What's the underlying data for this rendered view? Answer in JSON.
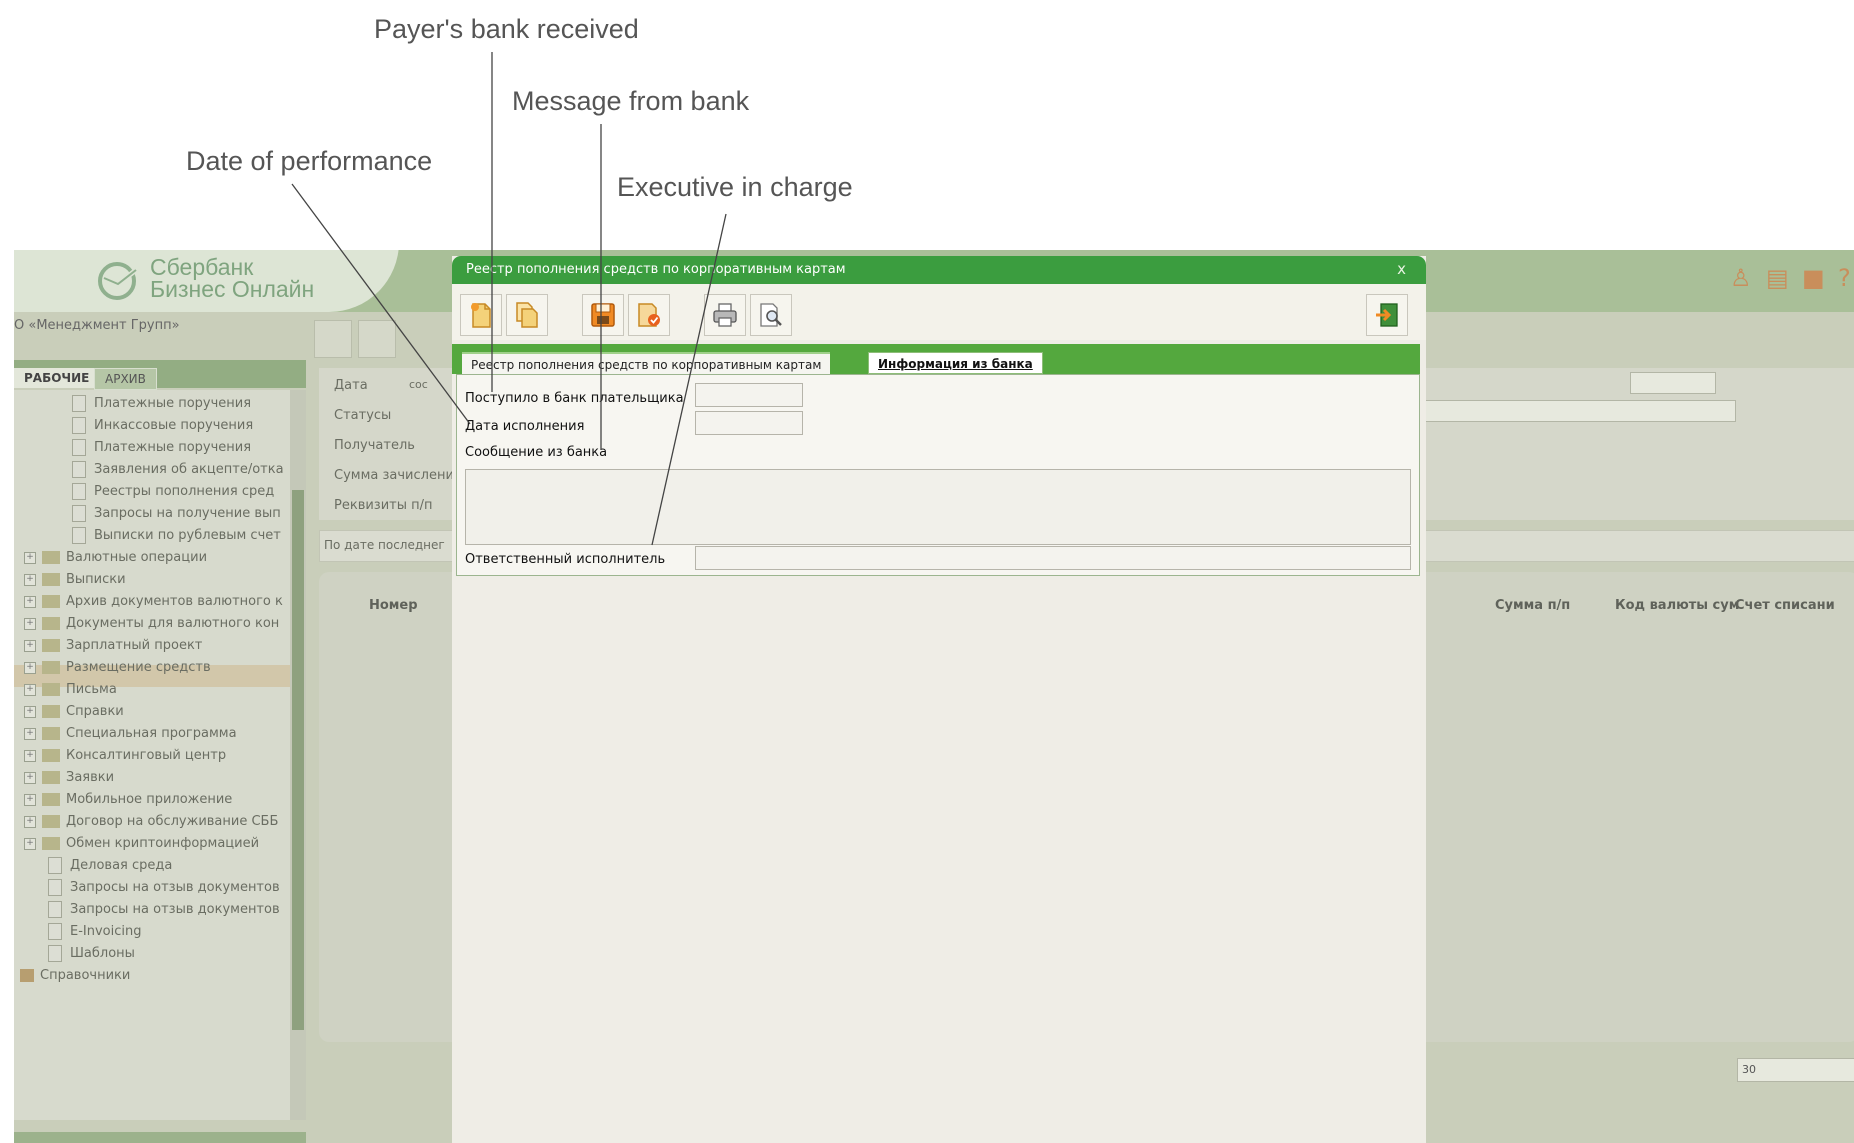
{
  "annotations": {
    "payers_bank_received": "Payer's bank received",
    "message_from_bank": "Message from bank",
    "date_of_performance": "Date of performance",
    "executive_in_charge": "Executive in charge"
  },
  "background_app": {
    "logo": {
      "line1": "Сбербанк",
      "line2": "Бизнес Онлайн"
    },
    "org_name": "О «Менеджмент Групп»",
    "tabs": {
      "working": "РАБОЧИЕ",
      "archive": "АРХИВ"
    },
    "tree": [
      "Платежные поручения",
      "Инкассовые поручения",
      "Платежные поручения",
      "Заявления об акцепте/отка",
      "Реестры пополнения сред",
      "Запросы на получение вып",
      "Выписки по рублевым счет",
      "Валютные операции",
      "Выписки",
      "Архив документов валютного к",
      "Документы для валютного кон",
      "Зарплатный проект",
      "Размещение средств",
      "Письма",
      "Справки",
      "Специальная программа",
      "Консалтинговый центр",
      "Заявки",
      "Мобильное приложение",
      "Договор на обслуживание СББ",
      "Обмен криптоинформацией",
      "Деловая среда",
      "Запросы на отзыв документов",
      "Запросы на отзыв документов",
      "E-Invoicing",
      "Шаблоны",
      "Справочники"
    ],
    "filter_labels": [
      "Дата",
      "Статусы",
      "Получатель",
      "Сумма зачислени",
      "Реквизиты п/п"
    ],
    "filter_date_value": "сос",
    "sort_text": "По дате последнег",
    "grid_headers": {
      "number": "Номер",
      "amount": "Сумма п/п",
      "currency_code": "Код валюты сум",
      "debit_account": "Счет списани"
    },
    "page_size": "30"
  },
  "modal": {
    "title": "Реестр пополнения средств по корпоративным картам",
    "close": "x",
    "toolbar_icons": [
      "new-document-icon",
      "copy-document-icon",
      "save-icon",
      "sign-icon",
      "print-icon",
      "preview-icon",
      "exit-icon"
    ],
    "tabs": {
      "registry": "Реестр пополнения средств по корпоративным картам",
      "bank_info": "Информация из банка"
    },
    "form": {
      "received_label": "Поступило в банк плательщика",
      "received_value": "",
      "execution_date_label": "Дата исполнения",
      "execution_date_value": "",
      "bank_message_label": "Сообщение из банка",
      "bank_message_value": "",
      "executor_label": "Ответственный исполнитель",
      "executor_value": ""
    }
  }
}
